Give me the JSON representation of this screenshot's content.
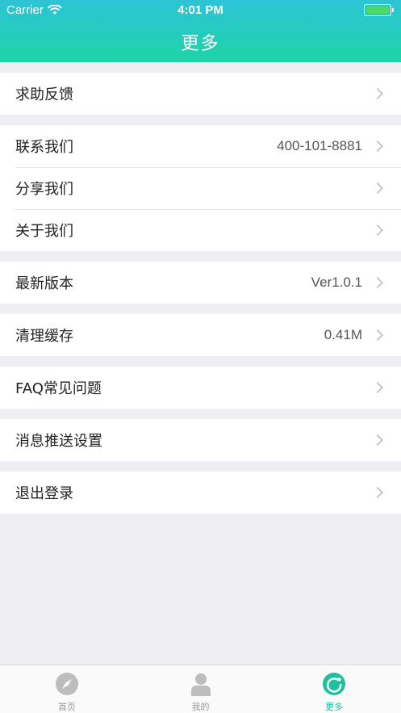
{
  "status_bar": {
    "carrier": "Carrier",
    "time": "4:01 PM"
  },
  "nav": {
    "title": "更多"
  },
  "sections": [
    {
      "rows": [
        {
          "label": "求助反馈",
          "value": ""
        }
      ]
    },
    {
      "rows": [
        {
          "label": "联系我们",
          "value": "400-101-8881"
        },
        {
          "label": "分享我们",
          "value": ""
        },
        {
          "label": "关于我们",
          "value": ""
        }
      ]
    },
    {
      "rows": [
        {
          "label": "最新版本",
          "value": "Ver1.0.1"
        }
      ]
    },
    {
      "rows": [
        {
          "label": "清理缓存",
          "value": "0.41M"
        }
      ]
    },
    {
      "rows": [
        {
          "label": "FAQ常见问题",
          "value": ""
        }
      ]
    },
    {
      "rows": [
        {
          "label": "消息推送设置",
          "value": ""
        }
      ]
    },
    {
      "rows": [
        {
          "label": "退出登录",
          "value": ""
        }
      ]
    }
  ],
  "tabbar": {
    "tabs": [
      {
        "label": "首页",
        "icon": "compass-icon",
        "active": false
      },
      {
        "label": "我的",
        "icon": "person-icon",
        "active": false
      },
      {
        "label": "更多",
        "icon": "refresh-icon",
        "active": true
      }
    ]
  },
  "colors": {
    "header_top": "#2cc4d6",
    "header_bottom": "#1fd3a6",
    "accent": "#1fbf9f"
  }
}
